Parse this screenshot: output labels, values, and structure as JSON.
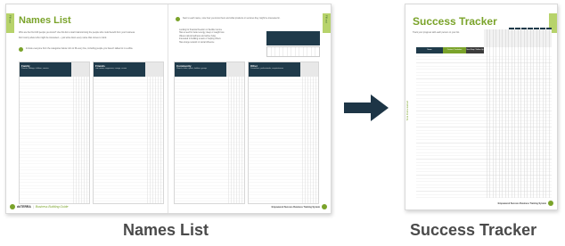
{
  "spread": {
    "left_tab": "Fill out",
    "right_tab": "Fill out",
    "title": "Names List",
    "subtitle_lines": [
      "Who are the first 100 people you know? Use this list to start brainstorming the people who could benefit from your business.",
      "Don't worry about who might be interested — just write down every name that comes to mind."
    ],
    "tip_text": "Include everyone from the categories below. Aim to fill every line, including people you haven't talked to in a while.",
    "columns": [
      {
        "title": "Family",
        "sub": "Parents, siblings, children, cousins"
      },
      {
        "title": "Friends",
        "sub": "Old friends, neighbours, college, school"
      },
      {
        "title": "Community",
        "sub": "Church, clubs, sports, hobbies, groups"
      },
      {
        "title": "Other",
        "sub": "Co-workers, professionals, acquaintances"
      }
    ],
    "right_intro": "Next to each name, note how you know them and what products or services they might be interested in.",
    "bullets": [
      "Looking for financial freedom or flexible income",
      "Has a need for better energy, sleep or weight loss",
      "Values natural wellness and active living",
      "Interested in building a team or helping others",
      "Has a large network or social influence"
    ],
    "footer_page": "56",
    "footer_brand": "dōTERRA",
    "footer_guide": "Business Building Guide",
    "footer_right": "Empowered Success Business Training System",
    "footer_right_page": "57"
  },
  "tracker": {
    "title": "Success Tracker",
    "subtitle": "Track your progress with each person on your list.",
    "col_headers": [
      "Name",
      "Contact / Invitation",
      "Next Step / Follow Up"
    ],
    "side_label": "Total Points Earned",
    "footer": "Empowered Success Business Training System",
    "footer_page": "59"
  },
  "captions": {
    "left": "Names List",
    "right": "Success Tracker"
  },
  "colors": {
    "accent_green": "#7aa32a",
    "tab_green": "#b7d36b",
    "header_navy": "#1f3a4a",
    "arrow_navy": "#1d3546",
    "caption_gray": "#4a4a4a"
  }
}
